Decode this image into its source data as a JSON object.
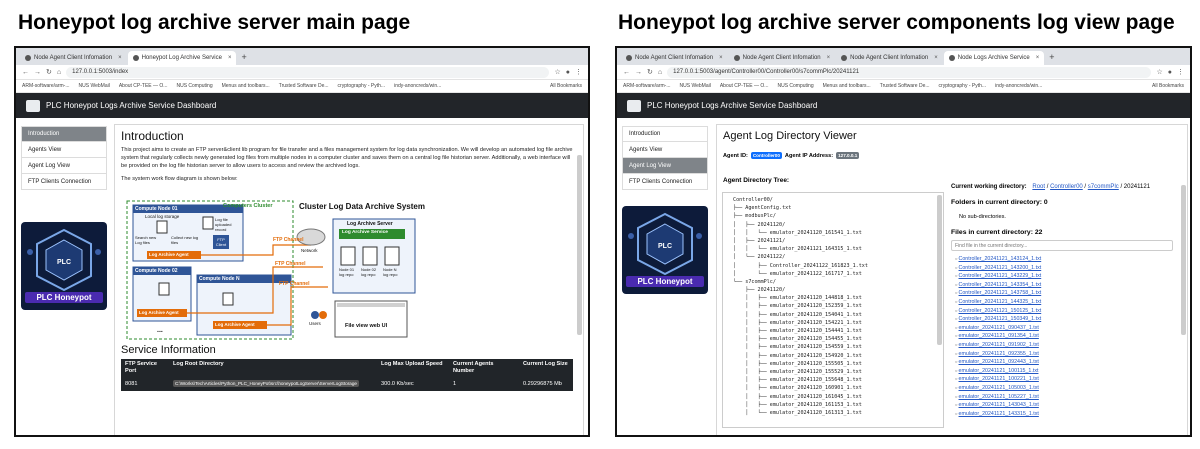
{
  "headings": {
    "left": "Honeypot log archive server main page",
    "right": "Honeypot log archive server components log view page"
  },
  "left": {
    "tabs": [
      "Node Agent Client Infomation",
      "Honeypot Log Archive Service"
    ],
    "url": "127.0.0.1:5003/index",
    "bookmarks": [
      "ARM-software/arm-...",
      "NUS WebMail",
      "About CP-TEE — O...",
      "NUS Computing",
      "Menus and toolbars...",
      "Trusted Software De...",
      "cryptography - Pyth...",
      "indy-anoncreds/win..."
    ],
    "all_bookmarks": "All Bookmarks",
    "app_title": "PLC Honeypot Logs Archive Service Dashboard",
    "sidebar": [
      "Introduction",
      "Agents View",
      "Agent Log View",
      "FTP Clients Connection"
    ],
    "logo_label": "PLC Honeypot",
    "intro_title": "Introduction",
    "intro_text": "This project aims to create an FTP server&client lib program for file transfer and a files management system for log data synchronization. We will develop an automated log file archive system that regularly collects newly generated log files from multiple nodes in a computer cluster and saves them on a central log file historian server. Additionally, a web interface will be provided on the log file historian server to allow users to access and review the archived logs.",
    "workflow_text": "The system work flow diagram is shown below:",
    "diagram": {
      "compute_node_01": "Compute Node 01",
      "computers_cluster": "Computers Cluster",
      "cluster_title": "Cluster Log Data Archive System",
      "local_log_storage": "Local log storage",
      "log_file_uploaded": "Log file uploaded record",
      "search_new": "Search new Log files",
      "collect_new": "Collect new log files",
      "ftp_client": "FTP Client",
      "log_archive_agent": "Log Archive Agent",
      "ftp_channel": "FTP Channel",
      "network": "Network",
      "log_archive_server": "Log Archive Server",
      "log_archive_service": "Log Archive Service",
      "compute_node_02": "Compute Node 02",
      "compute_node_n": "Compute Node N",
      "node_repo": [
        "Node 01 log repo",
        "Node 02 log repo",
        "Node N log repo"
      ],
      "users": "Users",
      "file_view": "File view web UI",
      "dots": "..."
    },
    "service_title": "Service Information",
    "service_table": {
      "headers": [
        "FTP Service Port",
        "Log Root Directory",
        "Log Max Upload Speed",
        "Current Agents Number",
        "Current Log Size"
      ],
      "row": [
        "8081",
        "C:\\Works\\TechArticles\\Python_PLC_HoneyPot\\src\\honeypotLogServer\\ServerLogStorage",
        "300.0 Kb/sec",
        "1",
        "0.29296875 Mb"
      ]
    }
  },
  "right": {
    "tabs": [
      "Node Agent Client Infomation",
      "Node Agent Client Infomation",
      "Node Agent Client Infomation",
      "Node Logs Archive Service"
    ],
    "url": "127.0.0.1:5003/agent/Controller00/Controller00/s7commPlc/20241121",
    "bookmarks": [
      "ARM-software/arm-...",
      "NUS WebMail",
      "About CP-TEE — O...",
      "NUS Computing",
      "Menus and toolbars...",
      "Trusted Software De...",
      "cryptography - Pyth...",
      "indy-anoncreds/win..."
    ],
    "all_bookmarks": "All Bookmarks",
    "app_title": "PLC Honeypot Logs Archive Service Dashboard",
    "sidebar": [
      "Introduction",
      "Agents View",
      "Agent Log View",
      "FTP Clients Connection"
    ],
    "logo_label": "PLC Honeypot",
    "viewer_title": "Agent Log Directory Viewer",
    "agent_id_label": "Agent ID:",
    "agent_id": "Controller00",
    "agent_ip_label": "Agent IP Address:",
    "agent_ip": "127.0.0.1",
    "tree_title": "Agent Directory Tree:",
    "tree": [
      "Controller00/",
      "├── AgentConfig.txt",
      "├── modbusPlc/",
      "│   ├── 20241120/",
      "│   │   └── emulator_20241120_161541_1.txt",
      "│   ├── 20241121/",
      "│   │   └── emulator_20241121_164315_1.txt",
      "│   └── 20241122/",
      "│       ├── Controller_20241122_161823_1.txt",
      "│       └── emulator_20241122_161717_1.txt",
      "└── s7commPlc/",
      "    ├── 20241120/",
      "    │   ├── emulator_20241120_144818_1.txt",
      "    │   ├── emulator_20241120_152359_1.txt",
      "    │   ├── emulator_20241120_154041_1.txt",
      "    │   ├── emulator_20241120_154221_1.txt",
      "    │   ├── emulator_20241120_154441_1.txt",
      "    │   ├── emulator_20241120_154455_1.txt",
      "    │   ├── emulator_20241120_154559_1.txt",
      "    │   ├── emulator_20241120_154920_1.txt",
      "    │   ├── emulator_20241120_155505_1.txt",
      "    │   ├── emulator_20241120_155529_1.txt",
      "    │   ├── emulator_20241120_155648_1.txt",
      "    │   ├── emulator_20241120_160901_1.txt",
      "    │   ├── emulator_20241120_161045_1.txt",
      "    │   ├── emulator_20241120_161153_1.txt",
      "    │   └── emulator_20241120_161313_1.txt"
    ],
    "cwd_label": "Current working directory:",
    "cwd_parts": [
      "Root",
      "Controller00",
      "s7commPlc"
    ],
    "cwd_current": "20241121",
    "folders_label": "Folders in current directory: 0",
    "no_sub": "No sub-directories.",
    "files_label": "Files in current directory: 22",
    "search_placeholder": "Find file in the current directory...",
    "files": [
      "Controller_20241121_143124_1.txt",
      "Controller_20241121_143200_1.txt",
      "Controller_20241121_143229_1.txt",
      "Controller_20241121_143354_1.txt",
      "Controller_20241121_143758_1.txt",
      "Controller_20241121_144325_1.txt",
      "Controller_20241121_150125_1.txt",
      "Controller_20241121_150349_1.txt",
      "emulator_20241121_090437_1.txt",
      "emulator_20241121_091354_1.txt",
      "emulator_20241121_091902_1.txt",
      "emulator_20241121_092355_1.txt",
      "emulator_20241121_092443_1.txt",
      "emulator_20241121_100115_1.txt",
      "emulator_20241121_100221_1.txt",
      "emulator_20241121_105003_1.txt",
      "emulator_20241121_105227_1.txt",
      "emulator_20241121_143043_1.txt",
      "emulator_20241121_143315_1.txt"
    ]
  },
  "colors": {
    "dark_bar": "#222529",
    "sidebar_active": "#7f8489",
    "link": "#2257c5",
    "badge_blue": "#0d6efd",
    "badge_gray": "#6c757d",
    "diagram_orange": "#e36c09",
    "diagram_green": "#2e8b2e",
    "diagram_blue": "#2f5597"
  }
}
